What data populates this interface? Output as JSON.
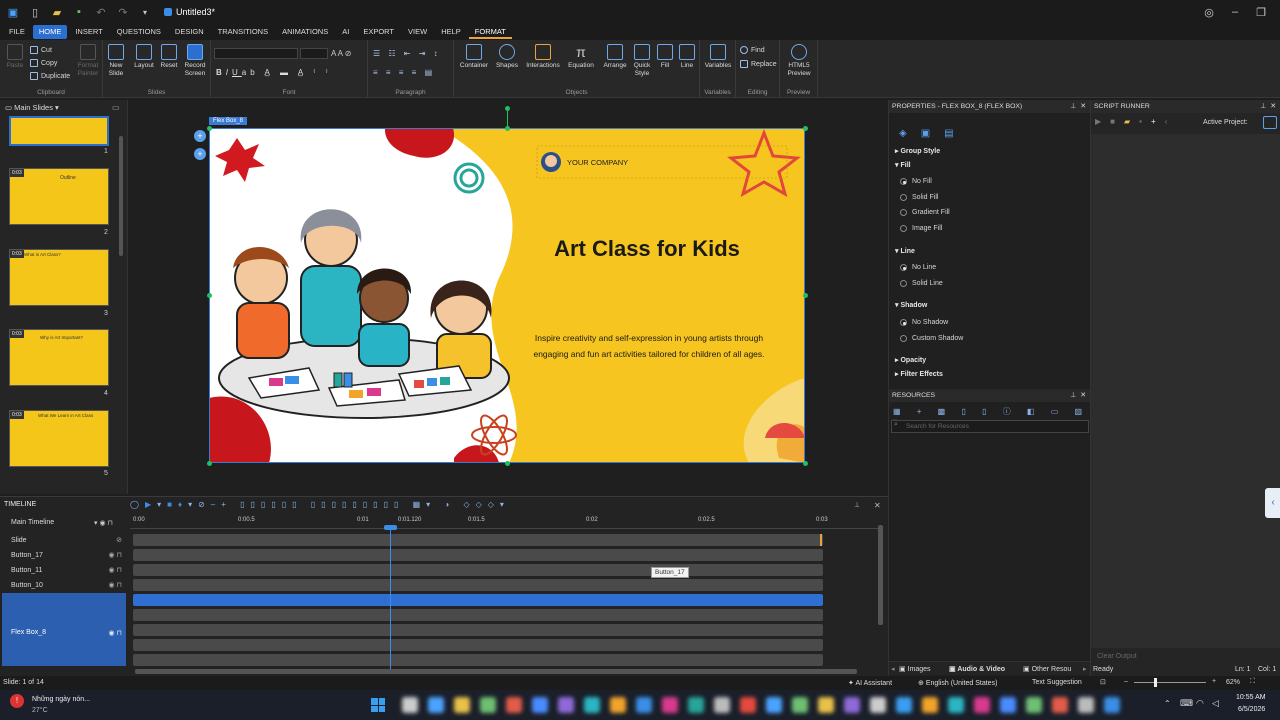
{
  "titlebar": {
    "doc_title": "Untitled3*",
    "app_icon": "app-logo-icon",
    "quick_access": [
      "new-file-icon",
      "open-folder-icon",
      "save-icon",
      "undo-icon",
      "redo-icon",
      "customize-icon"
    ],
    "win_controls": [
      "account-icon",
      "minimize-icon",
      "restore-icon",
      "close-icon"
    ]
  },
  "menu": [
    "FILE",
    "HOME",
    "INSERT",
    "QUESTIONS",
    "DESIGN",
    "TRANSITIONS",
    "ANIMATIONS",
    "AI",
    "EXPORT",
    "VIEW",
    "HELP",
    "FORMAT"
  ],
  "ribbon": {
    "clipboard": {
      "paste": "Paste",
      "cut": "Cut",
      "copy": "Copy",
      "duplicate": "Duplicate",
      "format_painter": "Format Painter",
      "label": "Clipboard"
    },
    "slides": {
      "new_slide": "New Slide",
      "layout": "Layout",
      "reset": "Reset",
      "record_screen": "Record Screen",
      "label": "Slides"
    },
    "font": {
      "label": "Font"
    },
    "paragraph": {
      "label": "Paragraph"
    },
    "objects": {
      "items": [
        "Container",
        "Shapes",
        "Interactions",
        "Equation",
        "Arrange",
        "Quick Style",
        "Fill",
        "Line"
      ],
      "label": "Objects"
    },
    "variables": {
      "btn": "Variables",
      "label": "Variables"
    },
    "editing": {
      "find": "Find",
      "replace": "Replace",
      "label": "Editing"
    },
    "preview": {
      "btn": "HTML5 Preview",
      "label": "Preview"
    }
  },
  "slides_panel": {
    "header": "Main Slides",
    "numbers": [
      "1",
      "2",
      "3",
      "4",
      "5"
    ],
    "titles": [
      "Outline",
      "What is Art Class?",
      "Why is Art Important?",
      "What We Learn in Art Class"
    ],
    "badge": "0:03"
  },
  "slide": {
    "selection_label": "Flex Box_8",
    "company": "YOUR COMPANY",
    "title": "Art Class for Kids",
    "body_line1": "Inspire creativity and self-expression in young artists through",
    "body_line2": "engaging and fun art activities tailored for children of all ages."
  },
  "properties": {
    "header": "PROPERTIES - FLEX BOX_8 (FLEX BOX)",
    "group_style": "Group Style",
    "fill": "Fill",
    "fill_options": [
      "No Fill",
      "Solid Fill",
      "Gradient Fill",
      "Image Fill"
    ],
    "line": "Line",
    "line_options": [
      "No Line",
      "Solid Line"
    ],
    "shadow": "Shadow",
    "shadow_options": [
      "No Shadow",
      "Custom Shadow"
    ],
    "opacity": "Opacity",
    "filter": "Filter Effects"
  },
  "resources": {
    "header": "RESOURCES",
    "search_placeholder": "Search for Resources",
    "tabs": [
      "Images",
      "Audio & Video",
      "Other Resou"
    ]
  },
  "script_runner": {
    "header": "SCRIPT RUNNER",
    "active_project": "Active Project:",
    "clear": "Clear Output",
    "ready": "Ready",
    "ln": "Ln: 1",
    "col": "Col: 1"
  },
  "timeline": {
    "header": "TIMELINE",
    "main": "Main Timeline",
    "ticks": [
      "0:00",
      "0:00.5",
      "0:01",
      "0:01.120",
      "0:01.5",
      "0:02",
      "0:02.5",
      "0:03"
    ],
    "rows": [
      "Slide",
      "Button_17",
      "Button_11",
      "Button_10",
      "Flex Box_8"
    ],
    "tooltip": "Button_17"
  },
  "status": {
    "slide": "Slide: 1 of 14",
    "ai": "AI Assistant",
    "lang": "English (United States)",
    "suggest": "Text Suggestion",
    "zoom": "62%"
  },
  "taskbar": {
    "news": "Những ngày nón...",
    "temp": "27°C",
    "time": "10:55 AM",
    "date": "6/5/2026"
  },
  "colors": {
    "accent": "#2b6fd1",
    "slide_yellow": "#f6c520",
    "selection_blue": "#3a7bd5",
    "handle_green": "#20c060"
  }
}
